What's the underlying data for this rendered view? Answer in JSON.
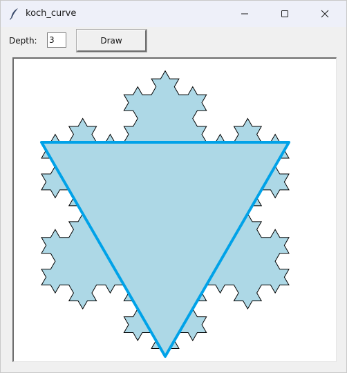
{
  "window": {
    "title": "koch_curve",
    "app_icon": "feather-icon",
    "controls": {
      "minimize": "minimize-icon",
      "maximize": "maximize-icon",
      "close": "close-icon"
    }
  },
  "toolbar": {
    "depth_label": "Depth:",
    "depth_value": "3",
    "draw_label": "Draw"
  },
  "canvas": {
    "depth": 3,
    "snowflake_fill": "#add8e6",
    "snowflake_stroke": "#000000",
    "triangle_stroke": "#00a2e8",
    "triangle_fill": "#add8e6"
  }
}
